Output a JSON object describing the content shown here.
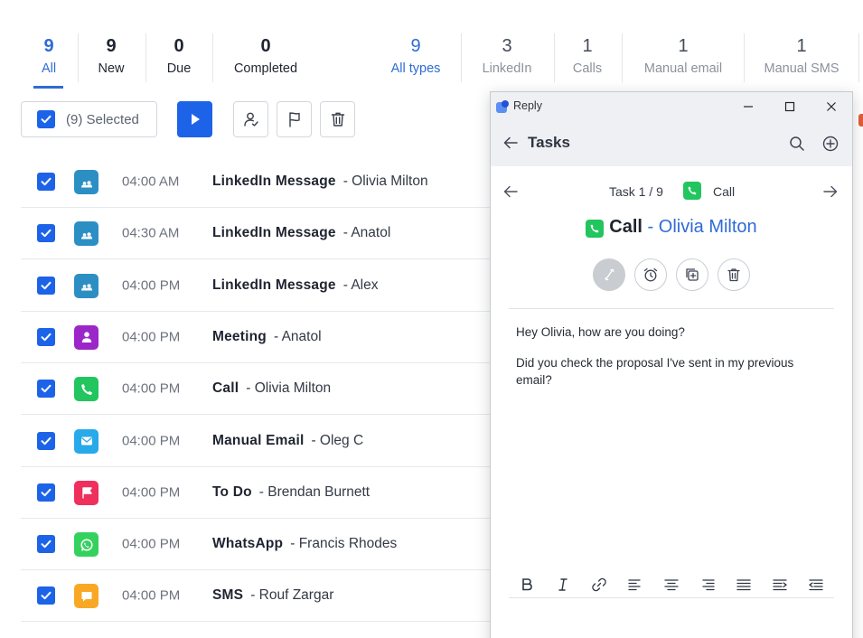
{
  "stats": [
    {
      "num": "9",
      "label": "All",
      "active": true
    },
    {
      "num": "9",
      "label": "New"
    },
    {
      "num": "0",
      "label": "Due"
    },
    {
      "num": "0",
      "label": "Completed"
    }
  ],
  "type_stats": [
    {
      "num": "9",
      "label": "All types",
      "active": true
    },
    {
      "num": "3",
      "label": "LinkedIn"
    },
    {
      "num": "1",
      "label": "Calls"
    },
    {
      "num": "1",
      "label": "Manual email"
    },
    {
      "num": "1",
      "label": "Manual SMS"
    }
  ],
  "toolbar": {
    "selected_label": "(9) Selected",
    "icons": [
      "play-icon",
      "assign-user-icon",
      "flag-icon",
      "trash-icon"
    ]
  },
  "tasks": [
    {
      "time": "04:00 AM",
      "type": "LinkedIn Message",
      "who": "- Olivia Milton",
      "icon": "linkedin-icon",
      "color": "#2c8fc4"
    },
    {
      "time": "04:30 AM",
      "type": "LinkedIn Message",
      "who": "- Anatol",
      "icon": "linkedin-icon",
      "color": "#2c8fc4"
    },
    {
      "time": "04:00 PM",
      "type": "LinkedIn Message",
      "who": "- Alex",
      "icon": "linkedin-icon",
      "color": "#2c8fc4"
    },
    {
      "time": "04:00 PM",
      "type": "Meeting",
      "who": "- Anatol",
      "icon": "meeting-icon",
      "color": "#9b27c9"
    },
    {
      "time": "04:00 PM",
      "type": "Call",
      "who": "- Olivia Milton",
      "icon": "phone-icon",
      "color": "#22c55e"
    },
    {
      "time": "04:00 PM",
      "type": "Manual Email",
      "who": "- Oleg C",
      "icon": "mail-icon",
      "color": "#27a9ea"
    },
    {
      "time": "04:00 PM",
      "type": "To Do",
      "who": "- Brendan Burnett",
      "icon": "flag-icon",
      "color": "#ef2f5c"
    },
    {
      "time": "04:00 PM",
      "type": "WhatsApp",
      "who": "- Francis Rhodes",
      "icon": "whatsapp-icon",
      "color": "#35d15f"
    },
    {
      "time": "04:00 PM",
      "type": "SMS",
      "who": "- Rouf Zargar",
      "icon": "sms-icon",
      "color": "#f9a825"
    }
  ],
  "window": {
    "app_name": "Reply",
    "heading": "Tasks",
    "task_counter": "Task 1 / 9",
    "task_type": "Call",
    "title_type": "Call",
    "title_contact": "- Olivia Milton",
    "message_lines": [
      "Hey Olivia, how are you doing?",
      "Did you check the proposal I've sent in my previous email?"
    ]
  },
  "colors": {
    "accent": "#1c63e8",
    "link": "#2e6bd6",
    "call_green": "#22c55e"
  }
}
